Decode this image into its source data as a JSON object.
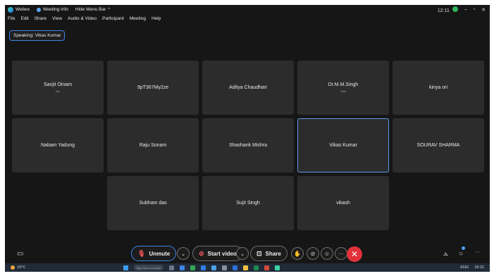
{
  "window": {
    "app_name": "Webex",
    "meeting_info": "Meeting Info",
    "hide_menu": "Hide Menu Bar",
    "clock": "12:11",
    "minimize": "–",
    "maximize": "▫",
    "close": "✕"
  },
  "menu": [
    "File",
    "Edit",
    "Share",
    "View",
    "Audio & Video",
    "Participant",
    "Meeting",
    "Help"
  ],
  "speaking": "Speaking: Vikas Kumar",
  "participants": [
    {
      "name": "Sanjit Oinam",
      "sub": "Me"
    },
    {
      "name": "9pT367My2ze",
      "sub": ""
    },
    {
      "name": "Aditya Chaudhari",
      "sub": ""
    },
    {
      "name": "Dr.M.M.Singh",
      "sub": "Host"
    },
    {
      "name": "kinya ori",
      "sub": ""
    },
    {
      "name": "Nabam Yadung",
      "sub": ""
    },
    {
      "name": "Raju Sonam",
      "sub": ""
    },
    {
      "name": "Shashank Mishra",
      "sub": ""
    },
    {
      "name": "Vikas Kumar",
      "sub": ""
    },
    {
      "name": "SOURAV SHARMA",
      "sub": ""
    },
    {
      "name": "Subham das",
      "sub": ""
    },
    {
      "name": "Sujit Singh",
      "sub": ""
    },
    {
      "name": "vikash",
      "sub": ""
    }
  ],
  "controls": {
    "unmute": "Unmute",
    "start_video": "Start video",
    "share": "Share",
    "more": "···",
    "end": "✕"
  },
  "taskbar": {
    "temperature": "19°C",
    "search_placeholder": "Type here to search",
    "language": "ENG",
    "time": "18:31"
  },
  "colors": {
    "accent": "#3d86e8",
    "end_call": "#e0313b",
    "muted_icon": "#ff5a5a",
    "tile_bg": "#2c2c2c",
    "bg": "#161616"
  }
}
